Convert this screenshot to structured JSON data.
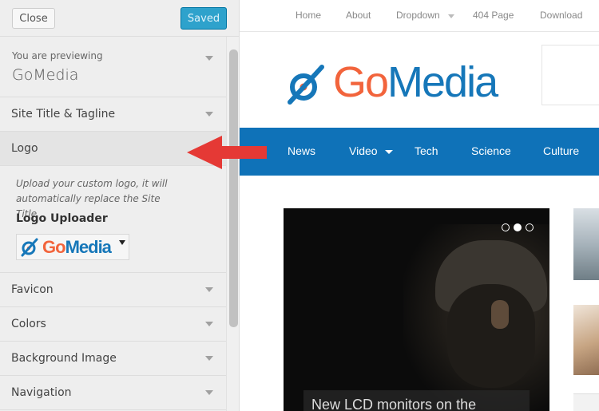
{
  "sidebar": {
    "close_label": "Close",
    "saved_label": "Saved",
    "preview_small": "You are previewing",
    "preview_theme": "GoMedia",
    "sections": {
      "site_title": "Site Title & Tagline",
      "logo": "Logo",
      "favicon": "Favicon",
      "colors": "Colors",
      "background_image": "Background Image",
      "navigation": "Navigation"
    },
    "logo_panel": {
      "description": "Upload your custom logo, it will automatically replace the Site Title",
      "uploader_label": "Logo Uploader",
      "thumb_text_a": "Go",
      "thumb_text_b": "Media"
    }
  },
  "site": {
    "topnav": [
      "Home",
      "About",
      "Dropdown",
      "404 Page",
      "Download"
    ],
    "logo_text_a": "Go",
    "logo_text_b": "Media",
    "mainnav": [
      "News",
      "Video",
      "Tech",
      "Science",
      "Culture"
    ],
    "hero_title": "New LCD monitors on the",
    "slider_active_index": 1
  },
  "colors": {
    "accent_blue": "#0f72b8",
    "logo_orange": "#f2643c",
    "logo_blue": "#1677b9",
    "saved_button": "#2ea2cc",
    "callout_red": "#e53935"
  }
}
